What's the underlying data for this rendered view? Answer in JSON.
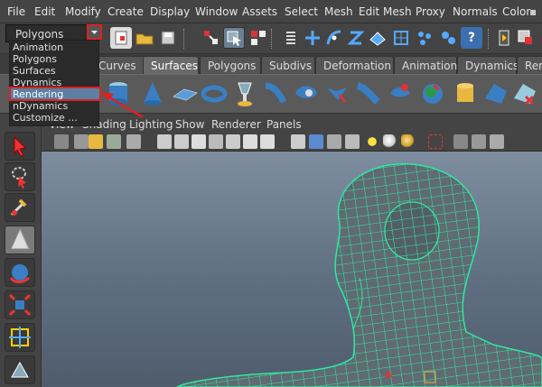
{
  "menubar": {
    "items": [
      "File",
      "Edit",
      "Modify",
      "Create",
      "Display",
      "Window",
      "Assets",
      "Select",
      "Mesh",
      "Edit Mesh",
      "Proxy",
      "Normals",
      "Color"
    ]
  },
  "status": {
    "menu_set_value": "Polygons"
  },
  "menu_set_options": [
    "Animation",
    "Polygons",
    "Surfaces",
    "Dynamics",
    "Rendering",
    "nDynamics",
    "Customize ..."
  ],
  "shelf_tabs": [
    "Curves",
    "Surfaces",
    "Polygons",
    "Subdivs",
    "Deformation",
    "Animation",
    "Dynamics",
    "Ren"
  ],
  "active_shelf_tab": "Surfaces",
  "panel_menu": [
    "View",
    "Shading",
    "Lighting",
    "Show",
    "Renderer",
    "Panels"
  ],
  "colors": {
    "highlight_border": "#e02020",
    "selection": "#5d7fa3",
    "wireframe": "#2fe8a0"
  }
}
